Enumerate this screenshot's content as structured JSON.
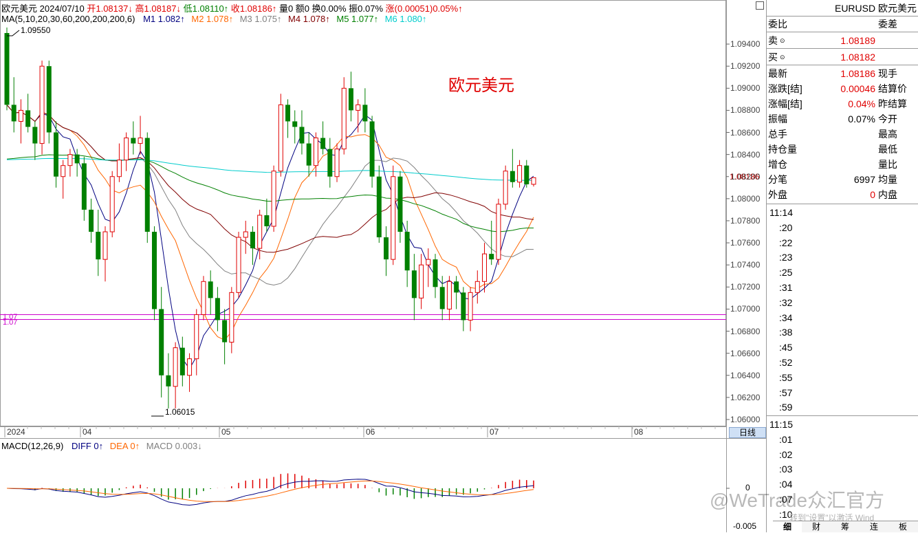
{
  "header": {
    "symbol": "欧元美元",
    "date": "2024/07/10",
    "open_label": "开",
    "open_value": "1.08137↓",
    "high_label": "高",
    "high_value": "1.08187↓",
    "low_label": "低",
    "low_value": "1.08110↑",
    "close_label": "收",
    "close_value": "1.08186↑",
    "volume": "量0",
    "amount": "额0",
    "turnover": "换0.00%",
    "amplitude": "振0.07%",
    "change_label": "涨",
    "change_value": "(0.00051)0.05%↑"
  },
  "ma_line": {
    "params": "MA(5,10,20,30,60,200,200,200,6)",
    "m1": "M1 1.082↑",
    "m2": "M2 1.078↑",
    "m3": "M3 1.075↑",
    "m4": "M4 1.078↑",
    "m5": "M5 1.077↑",
    "m6": "M6 1.080↑"
  },
  "chart_overlay": {
    "title": "欧元美元",
    "high_marker": "1.09550",
    "low_marker": "1.06015",
    "hline_label": "1.07",
    "price_tag": "1.08186"
  },
  "price_axis": [
    "1.09400",
    "1.09200",
    "1.09000",
    "1.08800",
    "1.08600",
    "1.08400",
    "1.08200",
    "1.08000",
    "1.07800",
    "1.07600",
    "1.07400",
    "1.07200",
    "1.07000",
    "1.06800",
    "1.06600",
    "1.06400",
    "1.06200",
    "1.06000"
  ],
  "time_axis": [
    "2024",
    "04",
    "05",
    "06",
    "07",
    "08"
  ],
  "period_button": "日线",
  "macd": {
    "label": "MACD(12,26,9)",
    "diff": "DIFF 0↑",
    "dea": "DEA 0↑",
    "macd": "MACD 0.003↓",
    "axis_zero": "0",
    "axis_neg": "-0.005"
  },
  "quote_panel": {
    "title": "EURUSD 欧元美元",
    "wei_bi": "委比",
    "wei_cha": "委差",
    "sell_label": "卖",
    "sell_value": "1.08189",
    "buy_label": "买",
    "buy_value": "1.08182",
    "rows": [
      {
        "l": "最新",
        "v": "1.08186",
        "r": "现手",
        "color": "#e00000"
      },
      {
        "l": "涨跌[结]",
        "v": "0.00046",
        "r": "结算价",
        "color": "#e00000"
      },
      {
        "l": "涨幅[结]",
        "v": "0.04%",
        "r": "昨结算",
        "color": "#e00000"
      },
      {
        "l": "振幅",
        "v": "0.07%",
        "r": "今开",
        "color": "#000000"
      },
      {
        "l": "总手",
        "v": "",
        "r": "最高",
        "color": "#000000"
      },
      {
        "l": "持仓量",
        "v": "",
        "r": "最低",
        "color": "#000000"
      },
      {
        "l": "增仓",
        "v": "",
        "r": "量比",
        "color": "#000000"
      },
      {
        "l": "分笔",
        "v": "6997",
        "r": "均量",
        "color": "#000000"
      },
      {
        "l": "外盘",
        "v": "0",
        "r": "内盘",
        "color": "#e00000"
      }
    ],
    "times1": [
      "11:14",
      ":20",
      ":22",
      ":23",
      ":25",
      ":31",
      ":32",
      ":34",
      ":38",
      ":45",
      ":52",
      ":55",
      ":57",
      ":59"
    ],
    "times2": [
      "11:15",
      ":01",
      ":02",
      ":03",
      ":04",
      ":07",
      ":10"
    ]
  },
  "tabs": [
    "细",
    "财",
    "筹",
    "连",
    "板"
  ],
  "watermark": "@WeTrade众汇官方",
  "watermark2": "转到\"设置\"以激活 Wind",
  "colors": {
    "up": "#e00000",
    "down": "#008000",
    "m1": "#000080",
    "m2": "#ff6600",
    "m3": "#808080",
    "m4": "#800000",
    "m5": "#008000",
    "m6": "#00cccc",
    "hline": "#cc00cc"
  },
  "chart_data": {
    "type": "candlestick",
    "y_range": [
      1.06,
      1.0955
    ],
    "candles": [
      [
        1.095,
        1.0955,
        1.088,
        1.0885
      ],
      [
        1.0885,
        1.091,
        1.086,
        1.087
      ],
      [
        1.087,
        1.089,
        1.085,
        1.088
      ],
      [
        1.088,
        1.0895,
        1.086,
        1.0865
      ],
      [
        1.0865,
        1.087,
        1.0835,
        1.085
      ],
      [
        1.085,
        1.0925,
        1.084,
        1.092
      ],
      [
        1.092,
        1.0925,
        1.085,
        1.086
      ],
      [
        1.086,
        1.087,
        1.081,
        1.082
      ],
      [
        1.082,
        1.0835,
        1.08,
        1.083
      ],
      [
        1.083,
        1.0845,
        1.082,
        1.084
      ],
      [
        1.084,
        1.0845,
        1.082,
        1.0832
      ],
      [
        1.0832,
        1.0838,
        1.078,
        1.079
      ],
      [
        1.079,
        1.08,
        1.076,
        1.077
      ],
      [
        1.077,
        1.079,
        1.073,
        1.0745
      ],
      [
        1.0745,
        1.0775,
        1.0725,
        1.077
      ],
      [
        1.077,
        1.0825,
        1.0765,
        1.082
      ],
      [
        1.082,
        1.085,
        1.0815,
        1.0835
      ],
      [
        1.0835,
        1.086,
        1.0825,
        1.0855
      ],
      [
        1.0855,
        1.087,
        1.084,
        1.085
      ],
      [
        1.085,
        1.0875,
        1.084,
        1.0855
      ],
      [
        1.0855,
        1.086,
        1.076,
        1.077
      ],
      [
        1.077,
        1.0775,
        1.069,
        1.07
      ],
      [
        1.07,
        1.072,
        1.062,
        1.064
      ],
      [
        1.064,
        1.066,
        1.061,
        1.063
      ],
      [
        1.063,
        1.067,
        1.061,
        1.0665
      ],
      [
        1.0665,
        1.0675,
        1.063,
        1.064
      ],
      [
        1.064,
        1.066,
        1.0625,
        1.0655
      ],
      [
        1.0655,
        1.07,
        1.064,
        1.0695
      ],
      [
        1.0695,
        1.073,
        1.069,
        1.0725
      ],
      [
        1.0725,
        1.0735,
        1.0695,
        1.071
      ],
      [
        1.071,
        1.072,
        1.068,
        1.069
      ],
      [
        1.069,
        1.07,
        1.065,
        1.067
      ],
      [
        1.067,
        1.072,
        1.066,
        1.0715
      ],
      [
        1.0715,
        1.077,
        1.071,
        1.0765
      ],
      [
        1.0765,
        1.078,
        1.075,
        1.077
      ],
      [
        1.077,
        1.0775,
        1.074,
        1.0755
      ],
      [
        1.0755,
        1.079,
        1.0745,
        1.0785
      ],
      [
        1.0785,
        1.08,
        1.077,
        1.0775
      ],
      [
        1.0775,
        1.083,
        1.077,
        1.0825
      ],
      [
        1.0825,
        1.0895,
        1.082,
        1.0885
      ],
      [
        1.0885,
        1.089,
        1.0855,
        1.087
      ],
      [
        1.087,
        1.088,
        1.085,
        1.0865
      ],
      [
        1.0865,
        1.088,
        1.084,
        1.085
      ],
      [
        1.085,
        1.086,
        1.082,
        1.083
      ],
      [
        1.083,
        1.086,
        1.082,
        1.0855
      ],
      [
        1.0855,
        1.087,
        1.084,
        1.0845
      ],
      [
        1.0845,
        1.0855,
        1.081,
        1.082
      ],
      [
        1.082,
        1.085,
        1.0815,
        1.0845
      ],
      [
        1.0845,
        1.091,
        1.084,
        1.09
      ],
      [
        1.09,
        1.0915,
        1.087,
        1.088
      ],
      [
        1.088,
        1.089,
        1.086,
        1.0885
      ],
      [
        1.0885,
        1.09,
        1.086,
        1.087
      ],
      [
        1.087,
        1.0875,
        1.081,
        1.082
      ],
      [
        1.082,
        1.083,
        1.076,
        1.0765
      ],
      [
        1.0765,
        1.0775,
        1.073,
        1.0745
      ],
      [
        1.0745,
        1.083,
        1.074,
        1.082
      ],
      [
        1.082,
        1.0825,
        1.076,
        1.077
      ],
      [
        1.077,
        1.078,
        1.072,
        1.0735
      ],
      [
        1.0735,
        1.075,
        1.069,
        1.071
      ],
      [
        1.071,
        1.075,
        1.07,
        1.074
      ],
      [
        1.074,
        1.0755,
        1.072,
        1.0745
      ],
      [
        1.0745,
        1.075,
        1.071,
        1.072
      ],
      [
        1.072,
        1.073,
        1.069,
        1.07
      ],
      [
        1.07,
        1.073,
        1.069,
        1.0725
      ],
      [
        1.0725,
        1.073,
        1.07,
        1.0715
      ],
      [
        1.0715,
        1.072,
        1.068,
        1.069
      ],
      [
        1.069,
        1.072,
        1.068,
        1.0715
      ],
      [
        1.0715,
        1.0735,
        1.0705,
        1.0725
      ],
      [
        1.0725,
        1.076,
        1.0715,
        1.075
      ],
      [
        1.075,
        1.078,
        1.074,
        1.0745
      ],
      [
        1.0745,
        1.08,
        1.074,
        1.0795
      ],
      [
        1.0795,
        1.083,
        1.079,
        1.0825
      ],
      [
        1.0825,
        1.0845,
        1.081,
        1.0815
      ],
      [
        1.0815,
        1.0835,
        1.081,
        1.083
      ],
      [
        1.083,
        1.0835,
        1.081,
        1.0813
      ],
      [
        1.0813,
        1.0819,
        1.0811,
        1.0819
      ]
    ]
  }
}
